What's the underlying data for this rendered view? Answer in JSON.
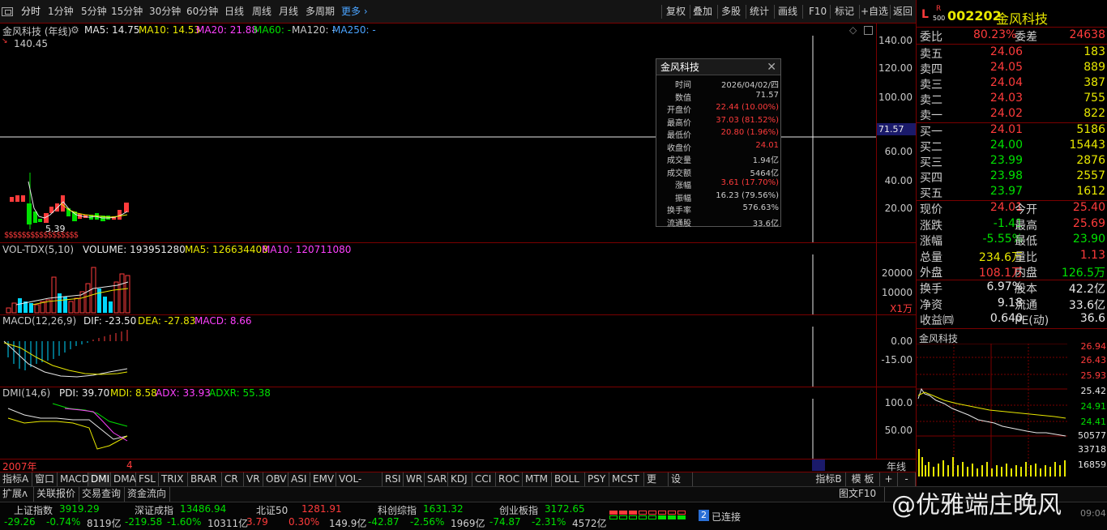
{
  "toolbar": {
    "periods": [
      "分时",
      "1分钟",
      "5分钟",
      "15分钟",
      "30分钟",
      "60分钟",
      "日线",
      "周线",
      "月线",
      "多周期"
    ],
    "more": "更多",
    "buttons": [
      "复权",
      "叠加",
      "多股",
      "统计",
      "画线",
      "F10",
      "标记",
      "+自选",
      "返回"
    ]
  },
  "kline": {
    "stock_label": "金风科技 (年线)",
    "ma5": "MA5: 14.75",
    "ma10": "MA10: 14.53",
    "ma20": "MA20: 21.88",
    "ma60": "MA60: -",
    "ma120": "MA120: -",
    "ma250": "MA250: -",
    "high_mark": "140.45",
    "low_mark": "5.39",
    "axis": [
      "140.00",
      "120.00",
      "100.00",
      "80.00",
      "60.00",
      "40.00",
      "20.00"
    ],
    "cursor_value": "71.57",
    "dollar_marks": "$$$$$$$$$$$$$$$$$"
  },
  "tooltip": {
    "title": "金风科技",
    "rows": [
      {
        "label": "时间",
        "value": "2026/04/02/四",
        "color": "#cccccc"
      },
      {
        "label": "数值",
        "value": "71.57",
        "color": "#cccccc"
      },
      {
        "label": "开盘价",
        "value": "22.44 (10.00%)",
        "color": "#ff3b3b"
      },
      {
        "label": "最高价",
        "value": "37.03 (81.52%)",
        "color": "#ff3b3b"
      },
      {
        "label": "最低价",
        "value": "20.80 (1.96%)",
        "color": "#ff3b3b"
      },
      {
        "label": "收盘价",
        "value": "24.01",
        "color": "#ff3b3b"
      },
      {
        "label": "成交量",
        "value": "1.94亿",
        "color": "#cccccc"
      },
      {
        "label": "成交额",
        "value": "5464亿",
        "color": "#cccccc"
      },
      {
        "label": "涨幅",
        "value": "3.61 (17.70%)",
        "color": "#ff3b3b"
      },
      {
        "label": "振幅",
        "value": "16.23 (79.56%)",
        "color": "#cccccc"
      },
      {
        "label": "换手率",
        "value": "576.63%",
        "color": "#cccccc"
      },
      {
        "label": "流通股",
        "value": "33.6亿",
        "color": "#cccccc"
      }
    ]
  },
  "vol": {
    "label": "VOL-TDX(5,10)",
    "volume": "VOLUME: 193951280",
    "ma5": "MA5: 126634408",
    "ma10": "MA10: 120711080",
    "axis": [
      "20000",
      "10000"
    ],
    "unit": "X1万"
  },
  "macd": {
    "label": "MACD(12,26,9)",
    "dif": "DIF: -23.50",
    "dea": "DEA: -27.83",
    "macd": "MACD: 8.66",
    "axis": [
      "0.00",
      "-15.00"
    ]
  },
  "dmi": {
    "label": "DMI(14,6)",
    "pdi": "PDI: 39.70",
    "mdi": "MDI: 8.58",
    "adx": "ADX: 33.93",
    "adxr": "ADXR: 55.38",
    "axis": [
      "100.0",
      "50.00"
    ]
  },
  "xaxis": {
    "start": "2007年",
    "mark": "4",
    "period": "年线"
  },
  "bottom_tabs": [
    "指标A",
    "窗口",
    "MACD",
    "DMI",
    "DMA",
    "FSL",
    "TRIX",
    "BRAR",
    "CR",
    "VR",
    "OBV",
    "ASI",
    "EMV",
    "VOL-TDX",
    "RSI",
    "WR",
    "SAR",
    "KDJ",
    "CCI",
    "ROC",
    "MTM",
    "BOLL",
    "PSY",
    "MCST",
    "更多",
    "设置"
  ],
  "bottom_tabs_right": [
    "指标B",
    "模 板",
    "+",
    "-"
  ],
  "bottom2_tabs": [
    "扩展ʌ",
    "关联报价",
    "交易查询",
    "资金流向"
  ],
  "bottom2_right": "图文F10",
  "quote": {
    "badge_l": "L",
    "badge_r": "R",
    "badge_500": "500",
    "code": "002202",
    "name": "金风科技",
    "weibi_label": "委比",
    "weibi": "80.23%",
    "weicha_label": "委差",
    "weicha": "24638",
    "sells": [
      {
        "label": "卖五",
        "price": "24.06",
        "vol": "183"
      },
      {
        "label": "卖四",
        "price": "24.05",
        "vol": "889"
      },
      {
        "label": "卖三",
        "price": "24.04",
        "vol": "387"
      },
      {
        "label": "卖二",
        "price": "24.03",
        "vol": "755"
      },
      {
        "label": "卖一",
        "price": "24.02",
        "vol": "822"
      }
    ],
    "buys": [
      {
        "label": "买一",
        "price": "24.01",
        "vol": "5186"
      },
      {
        "label": "买二",
        "price": "24.00",
        "vol": "15443"
      },
      {
        "label": "买三",
        "price": "23.99",
        "vol": "2876"
      },
      {
        "label": "买四",
        "price": "23.98",
        "vol": "2557"
      },
      {
        "label": "买五",
        "price": "23.97",
        "vol": "1612"
      }
    ],
    "stats": [
      {
        "l1": "现价",
        "v1": "24.01",
        "c1": "#ff3b3b",
        "l2": "今开",
        "v2": "25.40",
        "c2": "#ff3b3b"
      },
      {
        "l1": "涨跌",
        "v1": "-1.41",
        "c1": "#00e000",
        "l2": "最高",
        "v2": "25.69",
        "c2": "#ff3b3b"
      },
      {
        "l1": "涨幅",
        "v1": "-5.55%",
        "c1": "#00e000",
        "l2": "最低",
        "v2": "23.90",
        "c2": "#00e000"
      },
      {
        "l1": "总量",
        "v1": "234.6万",
        "c1": "#e8e800",
        "l2": "量比",
        "v2": "1.13",
        "c2": "#ff3b3b"
      },
      {
        "l1": "外盘",
        "v1": "108.1万",
        "c1": "#ff3b3b",
        "l2": "内盘",
        "v2": "126.5万",
        "c2": "#00e000"
      }
    ],
    "stats2": [
      {
        "l1": "换手",
        "v1": "6.97%",
        "c1": "#e8e8e8",
        "l2": "股本",
        "v2": "42.2亿",
        "c2": "#e8e8e8"
      },
      {
        "l1": "净资",
        "v1": "9.18",
        "c1": "#e8e8e8",
        "l2": "流通",
        "v2": "33.6亿",
        "c2": "#e8e8e8"
      },
      {
        "l1": "收益㈣",
        "v1": "0.640",
        "c1": "#e8e8e8",
        "l2": "PE(动)",
        "v2": "36.6",
        "c2": "#e8e8e8"
      }
    ]
  },
  "mini": {
    "title": "金风科技",
    "price_axis": [
      "26.94",
      "26.43",
      "25.93",
      "25.42",
      "24.91",
      "24.41"
    ],
    "vol_axis": [
      "50577",
      "33718",
      "16859"
    ]
  },
  "status": {
    "indices": [
      {
        "name": "上证指数",
        "value": "3919.29",
        "chg": "-29.26",
        "pct": "-0.74%",
        "amt": "8119亿"
      },
      {
        "name": "深证成指",
        "value": "13486.94",
        "chg": "-219.58",
        "pct": "-1.60%",
        "amt": "10311亿"
      },
      {
        "name": "北证50",
        "value": "1281.91",
        "chg": "3.79",
        "pct": "0.30%",
        "amt": "149.9亿"
      },
      {
        "name": "科创综指",
        "value": "1631.32",
        "chg": "-42.87",
        "pct": "-2.56%",
        "amt": "1969亿"
      },
      {
        "name": "创业板指",
        "value": "3172.65",
        "chg": "-74.87",
        "pct": "-2.31%",
        "amt": "4572亿"
      }
    ],
    "conn_num": "2",
    "conn": "已连接",
    "watermark": "@优雅端庄晚风",
    "clock": "09:04"
  },
  "colors": {
    "up": "#ff3b3b",
    "down": "#00e000",
    "accent": "#4aa3ff",
    "frame": "#7a0000"
  }
}
